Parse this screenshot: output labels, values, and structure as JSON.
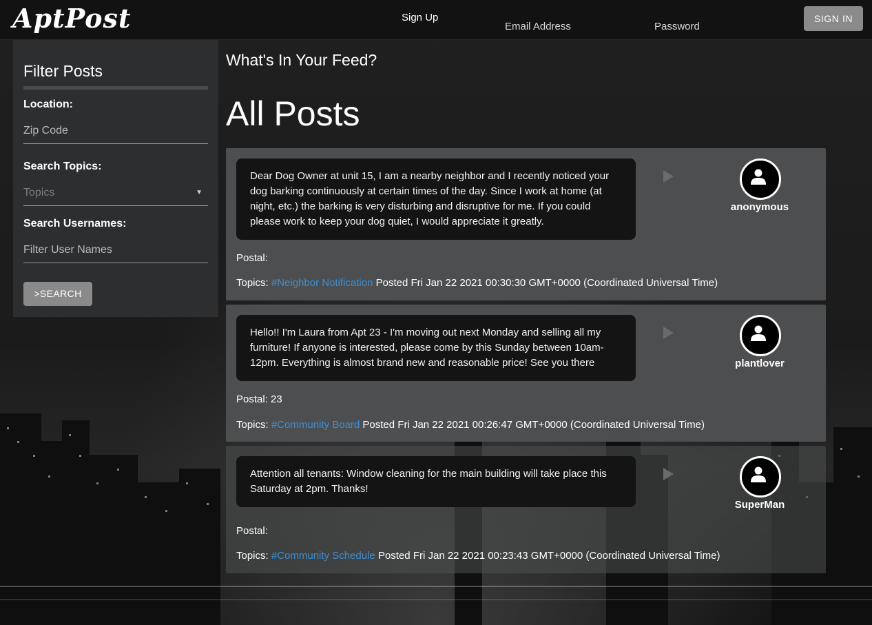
{
  "navbar": {
    "logo": "AptPost",
    "signup_label": "Sign Up",
    "email_placeholder": "Email Address",
    "password_placeholder": "Password",
    "signin_label": "SIGN IN"
  },
  "sidebar": {
    "title": "Filter Posts",
    "location_label": "Location:",
    "zip_placeholder": "Zip Code",
    "topics_label": "Search Topics:",
    "topics_select": "Topics",
    "usernames_label": "Search Usernames:",
    "usernames_placeholder": "Filter User Names",
    "search_label": ">SEARCH"
  },
  "main": {
    "feed_title": "What's In Your Feed?",
    "heading": "All Posts"
  },
  "posts": [
    {
      "message": "Dear Dog Owner at unit 15, I am a nearby neighbor and I recently noticed your dog barking continuously at certain times of the day. Since I work at home (at night, etc.) the barking is very disturbing and disruptive for me. If you could please work to keep your dog quiet, I would appreciate it greatly.",
      "username": "anonymous",
      "postal": "Postal:",
      "topics_label": "Topics:",
      "topic": "#Neighbor Notification",
      "posted": "Posted Fri Jan 22 2021 00:30:30 GMT+0000 (Coordinated Universal Time)"
    },
    {
      "message": "Hello!! I'm Laura from Apt 23 - I'm moving out next Monday and selling all my furniture! If anyone is interested, please come by this Sunday between 10am-12pm. Everything is almost brand new and reasonable price! See you there",
      "username": "plantlover",
      "postal": "Postal: 23",
      "topics_label": "Topics:",
      "topic": "#Community Board",
      "posted": "Posted Fri Jan 22 2021 00:26:47 GMT+0000 (Coordinated Universal Time)"
    },
    {
      "message": "Attention all tenants: Window cleaning for the main building will take place this Saturday at 2pm. Thanks!",
      "username": "SuperMan",
      "postal": "Postal:",
      "topics_label": "Topics:",
      "topic": "#Community Schedule",
      "posted": "Posted Fri Jan 22 2021 00:23:43 GMT+0000 (Coordinated Universal Time)"
    }
  ],
  "icons": {
    "avatar": "user-icon",
    "dropdown": "chevron-down-icon"
  },
  "colors": {
    "link": "#3d8fd4",
    "button": "#8a8a8a"
  }
}
